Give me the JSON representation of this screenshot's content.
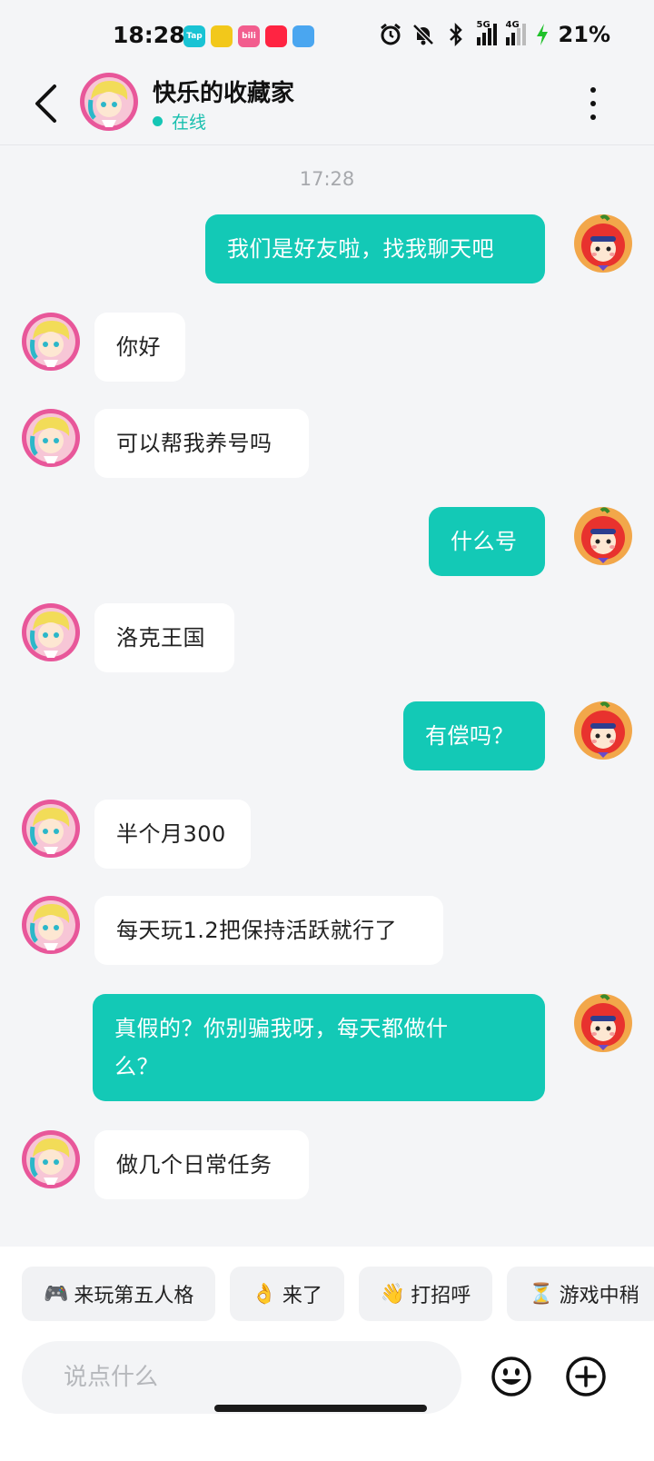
{
  "status_bar": {
    "time": "18:28",
    "app_icons": [
      {
        "name": "taptap-icon",
        "label": "Tap",
        "color": "#19c3d4"
      },
      {
        "name": "app-yellow-icon",
        "label": "",
        "color": "#f2c81b"
      },
      {
        "name": "bilibili-icon",
        "label": "bili",
        "color": "#f25d8e"
      },
      {
        "name": "xiaohongshu-icon",
        "label": "",
        "color": "#ff2442"
      },
      {
        "name": "weather-icon",
        "label": "",
        "color": "#4aa6f0"
      }
    ],
    "network_1": "5G",
    "network_2": "4G",
    "battery": "21%"
  },
  "header": {
    "contact_name": "快乐的收藏家",
    "status": "在线"
  },
  "chat": {
    "timestamp": "17:28",
    "messages": [
      {
        "dir": "out",
        "text": "我们是好友啦，找我聊天吧"
      },
      {
        "dir": "in",
        "text": "你好"
      },
      {
        "dir": "in",
        "text": "可以帮我养号吗"
      },
      {
        "dir": "out",
        "text": "什么号"
      },
      {
        "dir": "in",
        "text": "洛克王国"
      },
      {
        "dir": "out",
        "text": "有偿吗？"
      },
      {
        "dir": "in",
        "text": "半个月300"
      },
      {
        "dir": "in",
        "text": "每天玩1.2把保持活跃就行了"
      },
      {
        "dir": "out",
        "text": "真假的？你别骗我呀，每天都做什\n么？"
      },
      {
        "dir": "in",
        "text": "做几个日常任务"
      }
    ]
  },
  "quick_replies": [
    {
      "emoji": "🎮",
      "label": "来玩第五人格"
    },
    {
      "emoji": "👌",
      "label": "来了"
    },
    {
      "emoji": "👋",
      "label": "打招呼"
    },
    {
      "emoji": "⏳",
      "label": "游戏中稍"
    }
  ],
  "input": {
    "placeholder": "说点什么"
  },
  "colors": {
    "accent": "#13c9b6",
    "background": "#f4f5f7"
  }
}
